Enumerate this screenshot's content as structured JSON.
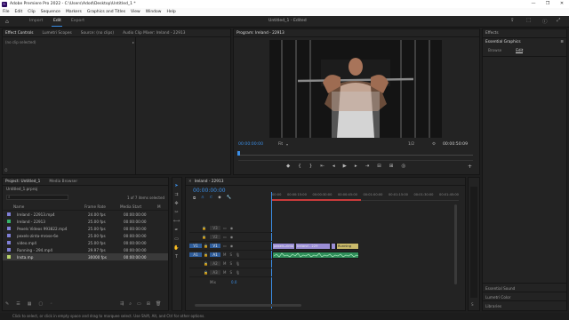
{
  "window": {
    "title": "Adobe Premiere Pro 2022 - C:\\Users\\Adod\\Desktop\\Untitled_1 *",
    "logo": "Pr",
    "controls": [
      "—",
      "❐",
      "✕"
    ]
  },
  "menu": [
    "File",
    "Edit",
    "Clip",
    "Sequence",
    "Markers",
    "Graphics and Titles",
    "View",
    "Window",
    "Help"
  ],
  "workspace": {
    "tabs": [
      "Import",
      "Edit",
      "Export"
    ],
    "active": "Edit",
    "doc_title": "Untitled_1 - Edited"
  },
  "effect_controls": {
    "tabs": [
      "Effect Controls",
      "Lumetri Scopes",
      "Source: (no clips)",
      "Audio Clip Mixer: Ireland - 22913"
    ],
    "placeholder": "(no clip selected)"
  },
  "program": {
    "title": "Program: Ireland - 22913",
    "timecode_in": "00:00:00:00",
    "fit": "Fit",
    "page": "1/2",
    "timecode_out": "00:00:50:09"
  },
  "right_panel": {
    "effects_label": "Effects",
    "essential_graphics": "Essential Graphics",
    "tabs": [
      "Browse",
      "Edit"
    ],
    "active_tab": "Edit",
    "bottom_items": [
      "Essential Sound",
      "Lumetri Color",
      "Libraries"
    ]
  },
  "project": {
    "tabs": [
      "Project: Untitled_1",
      "Media Browser"
    ],
    "file": "Untitled_1.prproj",
    "selected_info": "1 of 7 items selected",
    "columns": [
      "Name",
      "Frame Rate",
      "Media Start",
      "M"
    ],
    "rows": [
      {
        "name": "Ireland - 22913.mp4",
        "rate": "24.00 fps",
        "start": "00:00:00:00",
        "color": "#7f7fd6"
      },
      {
        "name": "Ireland - 22913",
        "rate": "25.00 fps",
        "start": "00:00:00:00",
        "color": "#36b36b"
      },
      {
        "name": "Pexels Videos 993822.mp4",
        "rate": "25.00 fps",
        "start": "00:00:00:00",
        "color": "#7f7fd6"
      },
      {
        "name": "pexels-zinta-mrose-6e",
        "rate": "25.00 fps",
        "start": "00:00:00:00",
        "color": "#7f7fd6"
      },
      {
        "name": "video.mp4",
        "rate": "25.00 fps",
        "start": "00:00:00:00",
        "color": "#7f7fd6"
      },
      {
        "name": "Running - 294.mp4",
        "rate": "29.97 fps",
        "start": "00:00:00:00",
        "color": "#7f7fd6"
      },
      {
        "name": "Insta.mp",
        "rate": "30000 fps",
        "start": "00:00:00:00",
        "color": "#b9d46b"
      }
    ]
  },
  "timeline": {
    "tab": "Ireland - 22913",
    "timecode": "00:00:00:00",
    "ruler": [
      "00:00",
      "00:00:15:00",
      "00:00:30:00",
      "00:00:45:00",
      "00:01:00:00",
      "00:01:15:00",
      "00:01:30:00",
      "00:01:45:00"
    ],
    "tracks": [
      "V3",
      "V2",
      "V1",
      "A1",
      "A2",
      "A3"
    ],
    "source_patch": [
      "V1",
      "A1"
    ],
    "mix_label": "Mix",
    "mix_value": "0.0",
    "clips_video": [
      {
        "label": "pexels-zinta",
        "color": "#9b8ed6"
      },
      {
        "label": "Ireland - 229",
        "color": "#9b8ed6"
      },
      {
        "label": "video.mp4",
        "color": "#9b8ed6"
      },
      {
        "label": "Running",
        "color": "#c9b96a"
      }
    ]
  },
  "status": "Click to select, or click in empty space and drag to marquee select. Use Shift, Alt, and Ctrl for other options."
}
